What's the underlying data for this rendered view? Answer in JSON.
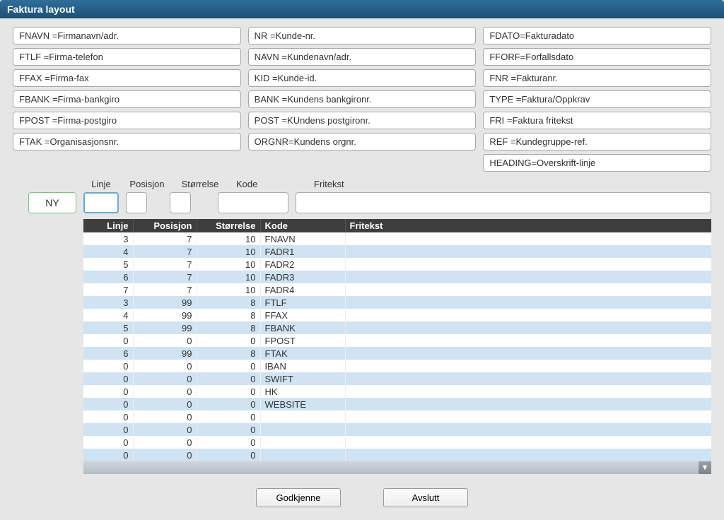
{
  "window": {
    "title": "Faktura layout"
  },
  "tokens": {
    "col1": [
      "FNAVN =Firmanavn/adr.",
      "FTLF  =Firma-telefon",
      "FFAX  =Firma-fax",
      "FBANK =Firma-bankgiro",
      "FPOST =Firma-postgiro",
      "FTAK  =Organisasjonsnr."
    ],
    "col2": [
      "NR   =Kunde-nr.",
      "NAVN =Kundenavn/adr.",
      "KID  =Kunde-id.",
      "BANK =Kundens bankgironr.",
      "POST =KUndens postgironr.",
      "ORGNR=Kundens orgnr."
    ],
    "col3": [
      "FDATO=Fakturadato",
      "FFORF=Forfallsdato",
      "FNR  =Fakturanr.",
      "TYPE =Faktura/Oppkrav",
      "FRI  =Faktura fritekst",
      "REF  =Kundegruppe-ref.",
      "HEADING=Overskrift-linje"
    ]
  },
  "inputLabels": {
    "linje": "Linje",
    "posisjon": "Posisjon",
    "storrelse": "Størrelse",
    "kode": "Kode",
    "fritekst": "Fritekst"
  },
  "inputs": {
    "ny_label": "NY",
    "linje": "",
    "posisjon": "",
    "storrelse": "",
    "kode": "",
    "fritekst": ""
  },
  "tableHeaders": {
    "linje": "Linje",
    "posisjon": "Posisjon",
    "storrelse": "Størrelse",
    "kode": "Kode",
    "fritekst": "Fritekst"
  },
  "rows": [
    {
      "linje": "3",
      "posisjon": "7",
      "storrelse": "10",
      "kode": "FNAVN",
      "fritekst": ""
    },
    {
      "linje": "4",
      "posisjon": "7",
      "storrelse": "10",
      "kode": "FADR1",
      "fritekst": ""
    },
    {
      "linje": "5",
      "posisjon": "7",
      "storrelse": "10",
      "kode": "FADR2",
      "fritekst": ""
    },
    {
      "linje": "6",
      "posisjon": "7",
      "storrelse": "10",
      "kode": "FADR3",
      "fritekst": ""
    },
    {
      "linje": "7",
      "posisjon": "7",
      "storrelse": "10",
      "kode": "FADR4",
      "fritekst": ""
    },
    {
      "linje": "3",
      "posisjon": "99",
      "storrelse": "8",
      "kode": "FTLF",
      "fritekst": ""
    },
    {
      "linje": "4",
      "posisjon": "99",
      "storrelse": "8",
      "kode": "FFAX",
      "fritekst": ""
    },
    {
      "linje": "5",
      "posisjon": "99",
      "storrelse": "8",
      "kode": "FBANK",
      "fritekst": ""
    },
    {
      "linje": "0",
      "posisjon": "0",
      "storrelse": "0",
      "kode": "FPOST",
      "fritekst": ""
    },
    {
      "linje": "6",
      "posisjon": "99",
      "storrelse": "8",
      "kode": "FTAK",
      "fritekst": ""
    },
    {
      "linje": "0",
      "posisjon": "0",
      "storrelse": "0",
      "kode": "IBAN",
      "fritekst": ""
    },
    {
      "linje": "0",
      "posisjon": "0",
      "storrelse": "0",
      "kode": "SWIFT",
      "fritekst": ""
    },
    {
      "linje": "0",
      "posisjon": "0",
      "storrelse": "0",
      "kode": "HK",
      "fritekst": ""
    },
    {
      "linje": "0",
      "posisjon": "0",
      "storrelse": "0",
      "kode": "WEBSITE",
      "fritekst": ""
    },
    {
      "linje": "0",
      "posisjon": "0",
      "storrelse": "0",
      "kode": "",
      "fritekst": ""
    },
    {
      "linje": "0",
      "posisjon": "0",
      "storrelse": "0",
      "kode": "",
      "fritekst": ""
    },
    {
      "linje": "0",
      "posisjon": "0",
      "storrelse": "0",
      "kode": "",
      "fritekst": ""
    },
    {
      "linje": "0",
      "posisjon": "0",
      "storrelse": "0",
      "kode": "",
      "fritekst": ""
    }
  ],
  "footer": {
    "approve": "Godkjenne",
    "close": "Avslutt"
  }
}
